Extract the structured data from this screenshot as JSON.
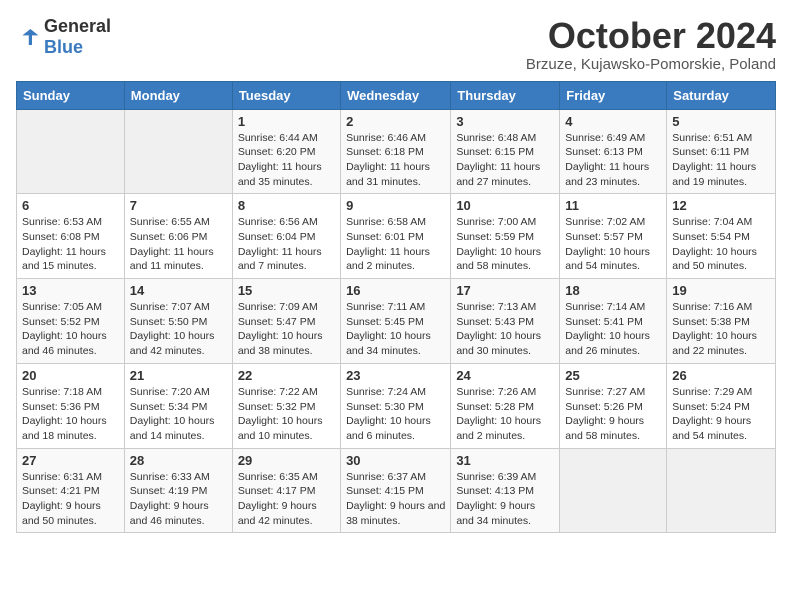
{
  "header": {
    "logo_general": "General",
    "logo_blue": "Blue",
    "month_title": "October 2024",
    "location": "Brzuze, Kujawsko-Pomorskie, Poland"
  },
  "weekdays": [
    "Sunday",
    "Monday",
    "Tuesday",
    "Wednesday",
    "Thursday",
    "Friday",
    "Saturday"
  ],
  "weeks": [
    [
      {
        "day": "",
        "info": ""
      },
      {
        "day": "",
        "info": ""
      },
      {
        "day": "1",
        "info": "Sunrise: 6:44 AM\nSunset: 6:20 PM\nDaylight: 11 hours and 35 minutes."
      },
      {
        "day": "2",
        "info": "Sunrise: 6:46 AM\nSunset: 6:18 PM\nDaylight: 11 hours and 31 minutes."
      },
      {
        "day": "3",
        "info": "Sunrise: 6:48 AM\nSunset: 6:15 PM\nDaylight: 11 hours and 27 minutes."
      },
      {
        "day": "4",
        "info": "Sunrise: 6:49 AM\nSunset: 6:13 PM\nDaylight: 11 hours and 23 minutes."
      },
      {
        "day": "5",
        "info": "Sunrise: 6:51 AM\nSunset: 6:11 PM\nDaylight: 11 hours and 19 minutes."
      }
    ],
    [
      {
        "day": "6",
        "info": "Sunrise: 6:53 AM\nSunset: 6:08 PM\nDaylight: 11 hours and 15 minutes."
      },
      {
        "day": "7",
        "info": "Sunrise: 6:55 AM\nSunset: 6:06 PM\nDaylight: 11 hours and 11 minutes."
      },
      {
        "day": "8",
        "info": "Sunrise: 6:56 AM\nSunset: 6:04 PM\nDaylight: 11 hours and 7 minutes."
      },
      {
        "day": "9",
        "info": "Sunrise: 6:58 AM\nSunset: 6:01 PM\nDaylight: 11 hours and 2 minutes."
      },
      {
        "day": "10",
        "info": "Sunrise: 7:00 AM\nSunset: 5:59 PM\nDaylight: 10 hours and 58 minutes."
      },
      {
        "day": "11",
        "info": "Sunrise: 7:02 AM\nSunset: 5:57 PM\nDaylight: 10 hours and 54 minutes."
      },
      {
        "day": "12",
        "info": "Sunrise: 7:04 AM\nSunset: 5:54 PM\nDaylight: 10 hours and 50 minutes."
      }
    ],
    [
      {
        "day": "13",
        "info": "Sunrise: 7:05 AM\nSunset: 5:52 PM\nDaylight: 10 hours and 46 minutes."
      },
      {
        "day": "14",
        "info": "Sunrise: 7:07 AM\nSunset: 5:50 PM\nDaylight: 10 hours and 42 minutes."
      },
      {
        "day": "15",
        "info": "Sunrise: 7:09 AM\nSunset: 5:47 PM\nDaylight: 10 hours and 38 minutes."
      },
      {
        "day": "16",
        "info": "Sunrise: 7:11 AM\nSunset: 5:45 PM\nDaylight: 10 hours and 34 minutes."
      },
      {
        "day": "17",
        "info": "Sunrise: 7:13 AM\nSunset: 5:43 PM\nDaylight: 10 hours and 30 minutes."
      },
      {
        "day": "18",
        "info": "Sunrise: 7:14 AM\nSunset: 5:41 PM\nDaylight: 10 hours and 26 minutes."
      },
      {
        "day": "19",
        "info": "Sunrise: 7:16 AM\nSunset: 5:38 PM\nDaylight: 10 hours and 22 minutes."
      }
    ],
    [
      {
        "day": "20",
        "info": "Sunrise: 7:18 AM\nSunset: 5:36 PM\nDaylight: 10 hours and 18 minutes."
      },
      {
        "day": "21",
        "info": "Sunrise: 7:20 AM\nSunset: 5:34 PM\nDaylight: 10 hours and 14 minutes."
      },
      {
        "day": "22",
        "info": "Sunrise: 7:22 AM\nSunset: 5:32 PM\nDaylight: 10 hours and 10 minutes."
      },
      {
        "day": "23",
        "info": "Sunrise: 7:24 AM\nSunset: 5:30 PM\nDaylight: 10 hours and 6 minutes."
      },
      {
        "day": "24",
        "info": "Sunrise: 7:26 AM\nSunset: 5:28 PM\nDaylight: 10 hours and 2 minutes."
      },
      {
        "day": "25",
        "info": "Sunrise: 7:27 AM\nSunset: 5:26 PM\nDaylight: 9 hours and 58 minutes."
      },
      {
        "day": "26",
        "info": "Sunrise: 7:29 AM\nSunset: 5:24 PM\nDaylight: 9 hours and 54 minutes."
      }
    ],
    [
      {
        "day": "27",
        "info": "Sunrise: 6:31 AM\nSunset: 4:21 PM\nDaylight: 9 hours and 50 minutes."
      },
      {
        "day": "28",
        "info": "Sunrise: 6:33 AM\nSunset: 4:19 PM\nDaylight: 9 hours and 46 minutes."
      },
      {
        "day": "29",
        "info": "Sunrise: 6:35 AM\nSunset: 4:17 PM\nDaylight: 9 hours and 42 minutes."
      },
      {
        "day": "30",
        "info": "Sunrise: 6:37 AM\nSunset: 4:15 PM\nDaylight: 9 hours and 38 minutes."
      },
      {
        "day": "31",
        "info": "Sunrise: 6:39 AM\nSunset: 4:13 PM\nDaylight: 9 hours and 34 minutes."
      },
      {
        "day": "",
        "info": ""
      },
      {
        "day": "",
        "info": ""
      }
    ]
  ]
}
